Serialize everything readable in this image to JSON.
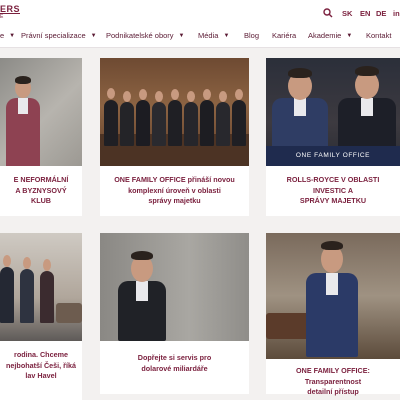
{
  "header": {
    "logo_text": "ERS",
    "logo_sub": "E",
    "languages": [
      "SK",
      "EN",
      "DE"
    ],
    "linkedin": "in"
  },
  "nav": [
    {
      "label": "e",
      "has_dropdown": true
    },
    {
      "label": "Právní specializace",
      "has_dropdown": true
    },
    {
      "label": "Podnikatelské obory",
      "has_dropdown": true
    },
    {
      "label": "Média",
      "has_dropdown": true
    },
    {
      "label": "Blog",
      "has_dropdown": false
    },
    {
      "label": "Kariéra",
      "has_dropdown": false
    },
    {
      "label": "Akademie",
      "has_dropdown": true
    },
    {
      "label": "Kontakt",
      "has_dropdown": false
    }
  ],
  "banner_text": "ONE FAMILY OFFICE",
  "cards": [
    {
      "title_lines": [
        "E NEFORMÁLNÍ",
        "A BYZNYSOVÝ KLUB"
      ]
    },
    {
      "title_lines": [
        "ONE FAMILY OFFICE přináší novou",
        "komplexní úroveň v oblasti",
        "správy majetku"
      ]
    },
    {
      "title_lines": [
        "ROLLS-ROYCE V OBLASTI INVESTIC A",
        "SPRÁVY MAJETKU"
      ]
    },
    {
      "title_lines": [
        "rodina. Chceme",
        "nejbohatší Češi, říká",
        "lav Havel"
      ]
    },
    {
      "title_lines": [
        "Dopřejte si servis pro",
        "dolarové miliardáře"
      ]
    },
    {
      "title_lines": [
        "ONE FAMILY OFFICE: Transparentnost",
        "detailní přístup"
      ]
    }
  ],
  "colors": {
    "brand": "#7a1f3d",
    "nav_text": "#5a1a33",
    "background": "#f3f1f0",
    "banner": "#1f2b4e"
  }
}
